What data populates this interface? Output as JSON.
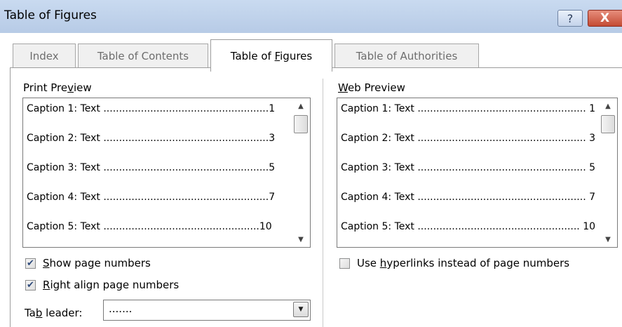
{
  "window": {
    "title": "Table of Figures",
    "help_label": "?",
    "close_label": "X"
  },
  "tabs": [
    {
      "label": "Index",
      "active": false
    },
    {
      "label": "Table of Contents",
      "active": false
    },
    {
      "label_pre": "Table of ",
      "label_ul": "F",
      "label_post": "igures",
      "active": true
    },
    {
      "label": "Table of Authorities",
      "active": false
    }
  ],
  "print_preview": {
    "label_pre": "Print Pre",
    "label_ul": "v",
    "label_post": "iew",
    "items": [
      "Caption 1: Text .....................................................1",
      "Caption 2: Text .....................................................3",
      "Caption 3: Text .....................................................5",
      "Caption 4: Text .....................................................7",
      "Caption 5: Text ..................................................10"
    ]
  },
  "web_preview": {
    "label_ul": "W",
    "label_post": "eb Preview",
    "items": [
      "Caption 1: Text ...................................................... 1",
      "Caption 2: Text ...................................................... 3",
      "Caption 3: Text ...................................................... 5",
      "Caption 4: Text ...................................................... 7",
      "Caption 5: Text .................................................... 10"
    ]
  },
  "options": {
    "show_page_numbers": {
      "ul": "S",
      "rest": "how page numbers",
      "checked": true
    },
    "right_align": {
      "ul": "R",
      "rest": "ight align page numbers",
      "checked": true
    },
    "hyperlinks": {
      "pre": "Use ",
      "ul": "h",
      "rest": "yperlinks instead of page numbers",
      "checked": false
    },
    "tab_leader": {
      "pre": "Ta",
      "ul": "b",
      "rest": " leader:",
      "value": "......."
    }
  },
  "colors": {
    "titlebar": "#c2d4ed",
    "close_button": "#c44b34",
    "check_mark": "#2e4a7a"
  }
}
